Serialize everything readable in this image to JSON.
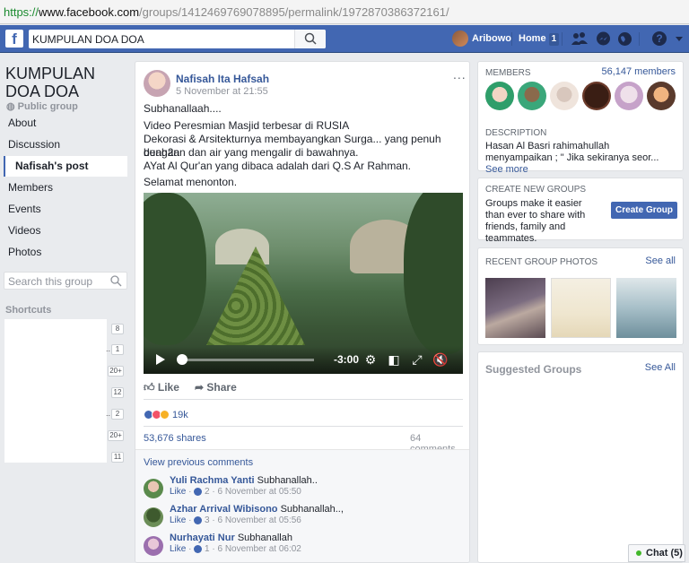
{
  "browser": {
    "url_protocol": "https://",
    "url_domain": "www.facebook.com",
    "url_path": "/groups/1412469769078895/permalink/1972870386372161/"
  },
  "topbar": {
    "logo": "f",
    "search_value": "KUMPULAN DOA DOA",
    "user_name": "Aribowo",
    "home_label": "Home",
    "home_count": "1"
  },
  "left": {
    "group_title": "KUMPULAN DOA DOA",
    "group_type": "Public group",
    "nav": [
      "About",
      "Discussion",
      "Nafisah's post",
      "Members",
      "Events",
      "Videos",
      "Photos"
    ],
    "search_placeholder": "Search this group",
    "shortcuts_label": "Shortcuts",
    "shortcut_counts": [
      "8",
      "1",
      "20+",
      "12",
      "2",
      "20+",
      "11"
    ]
  },
  "post": {
    "author": "Nafisah Ita Hafsah",
    "time": "5 November at 21:55",
    "more": "...",
    "line1": "Subhanallaah....",
    "body": [
      "Video Peresmian Masjid terbesar di RUSIA",
      "Dekorasi & Arsitekturnya membayangkan Surga... yang penuh dengan",
      "buah2an dan air yang mengalir di bawahnya.",
      "AYat Al Qur'an yang dibaca adalah dari Q.S Ar Rahman."
    ],
    "closing": "Selamat menonton.",
    "video_time": "-3:00",
    "video_progress": 0.02,
    "like_label": "Like",
    "share_label": "Share",
    "reaction_count": "19k",
    "shares": "53,676 shares",
    "comments": "64 comments",
    "view_previous": "View previous comments",
    "comment_list": [
      {
        "name": "Yuli Rachma Yanti",
        "text": "Subhanallah..",
        "like": "Like",
        "count": "2",
        "time": "6 November at 05:50"
      },
      {
        "name": "Azhar Arrival Wibisono",
        "text": "Subhanallah..,",
        "like": "Like",
        "count": "3",
        "time": "6 November at 05:56"
      },
      {
        "name": "Nurhayati Nur",
        "text": "Subhanallah",
        "like": "Like",
        "count": "1",
        "time": "6 November at 06:02"
      }
    ]
  },
  "right": {
    "members_label": "MEMBERS",
    "members_count": "56,147 members",
    "description_label": "DESCRIPTION",
    "description": "Hasan Al Basri rahimahullah menyampaikan ; \" Jika sekiranya seor...",
    "see_more": "See more",
    "create_label": "CREATE NEW GROUPS",
    "create_text": "Groups make it easier than ever to share with friends, family and teammates.",
    "create_button": "Create Group",
    "photos_label": "RECENT GROUP PHOTOS",
    "see_all": "See all",
    "suggested_label": "Suggested Groups",
    "suggested_see_all": "See All"
  },
  "chat": {
    "label": "Chat (5)"
  },
  "colors": {
    "brand": "#4267b2",
    "link": "#365899",
    "bg": "#e9ebee"
  }
}
